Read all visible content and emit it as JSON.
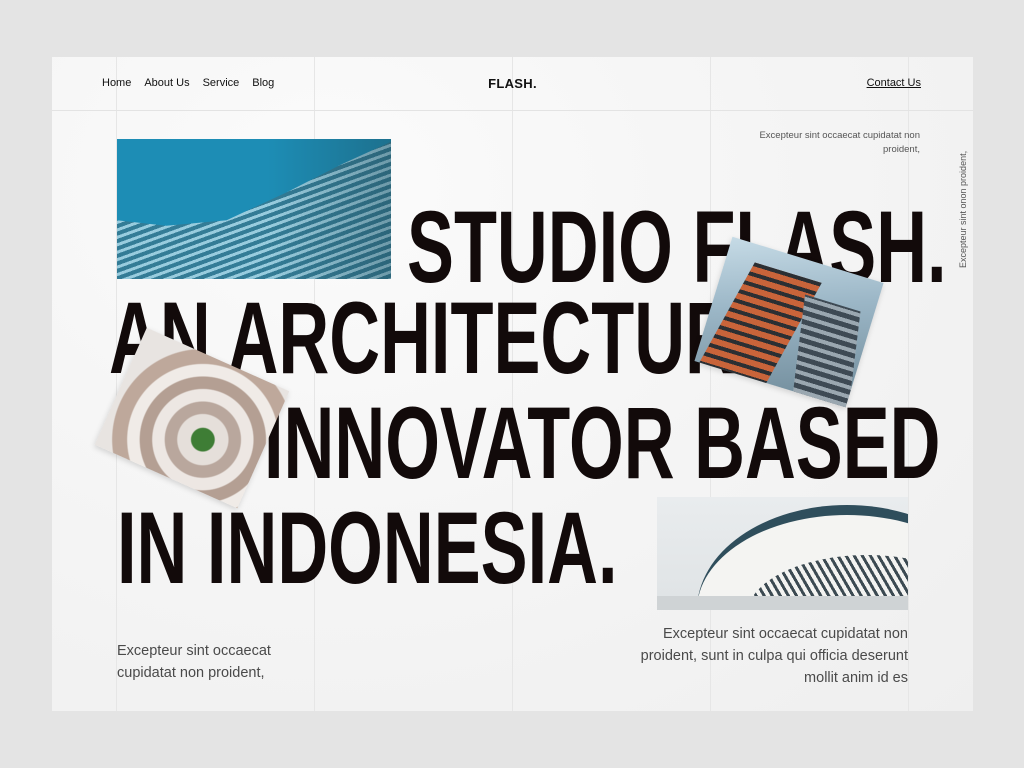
{
  "nav": {
    "items": [
      {
        "label": "Home"
      },
      {
        "label": "About Us"
      },
      {
        "label": "Service"
      },
      {
        "label": "Blog"
      }
    ]
  },
  "brand": "FLASH.",
  "contact_label": "Contact Us",
  "top_note": "Excepteur sint occaecat cupidatat non proident,",
  "side_note": "Excepteur sint onon proident,",
  "headline": {
    "line1": "STUDIO FLASH.",
    "line2": "AN ARCHITECTURAL",
    "line3": "INNOVATOR BASED",
    "line4": "IN INDONESIA."
  },
  "bottom_left_text": "Excepteur sint occaecat cupidatat non proident,",
  "bottom_right_text": "Excepteur sint occaecat cupidatat non proident, sunt in culpa qui officia deserunt mollit anim id es"
}
